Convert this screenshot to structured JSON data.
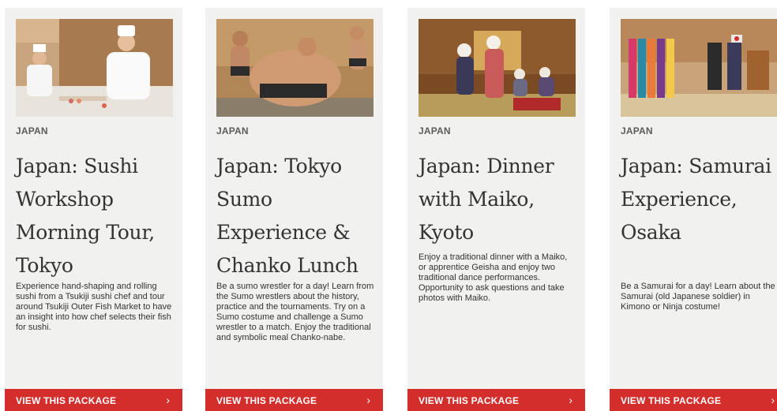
{
  "cards": [
    {
      "region": "JAPAN",
      "title": "Japan: Sushi Workshop Morning Tour, Tokyo",
      "description": "Experience hand-shaping and rolling sushi from a Tsukiji sushi chef and tour around Tsukiji Outer Fish Market to have an insight into how chef selects their fish for sushi.",
      "cta_label": "VIEW THIS PACKAGE",
      "arrow": "›"
    },
    {
      "region": "JAPAN",
      "title": "Japan: Tokyo Sumo Experience & Chanko Lunch",
      "description": "Be a sumo wrestler for a day! Learn from the Sumo wrestlers about the history, practice and the tournaments. Try on a Sumo costume and challenge a Sumo wrestler to a match. Enjoy the traditional and symbolic meal Chanko-nabe.",
      "cta_label": "VIEW THIS PACKAGE",
      "arrow": "›"
    },
    {
      "region": "JAPAN",
      "title": "Japan: Dinner with Maiko, Kyoto",
      "description": "Enjoy a traditional dinner with a Maiko, or apprentice Geisha and enjoy two traditional dance performances. Opportunity to ask questions and take photos with Maiko.",
      "cta_label": "VIEW THIS PACKAGE",
      "arrow": "›"
    },
    {
      "region": "JAPAN",
      "title": "Japan: Samurai Experience, Osaka",
      "description": "Be a Samurai for a day! Learn about the Samurai (old Japanese soldier) in Kimono or Ninja costume!",
      "cta_label": "VIEW THIS PACKAGE",
      "arrow": "›"
    }
  ],
  "colors": {
    "card_background": "#f1f1ef",
    "cta_background": "#d42e2c",
    "cta_text": "#ffffff",
    "text": "#333333"
  }
}
